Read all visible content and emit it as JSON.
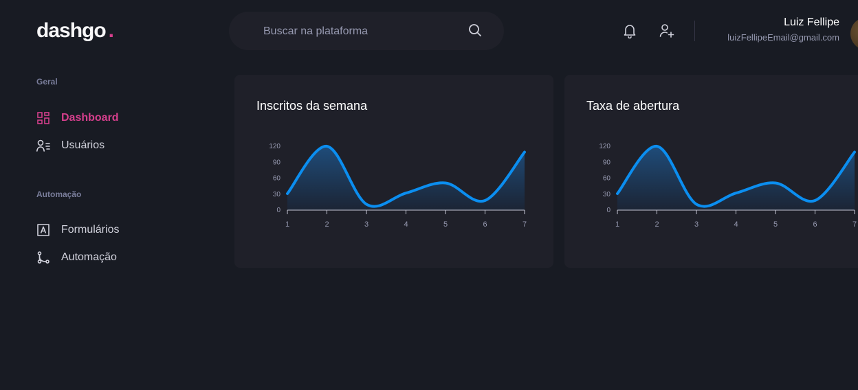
{
  "header": {
    "logo_text": "dashgo",
    "logo_dot": ".",
    "search_placeholder": "Buscar na plataforma",
    "profile": {
      "name": "Luiz Fellipe",
      "email": "luizFellipeEmail@gmail.com"
    }
  },
  "sidebar": {
    "sections": [
      {
        "title": "Geral",
        "items": [
          {
            "label": "Dashboard",
            "icon": "dashboard-icon",
            "active": true
          },
          {
            "label": "Usuários",
            "icon": "users-icon",
            "active": false
          }
        ]
      },
      {
        "title": "Automação",
        "items": [
          {
            "label": "Formulários",
            "icon": "form-icon",
            "active": false
          },
          {
            "label": "Automação",
            "icon": "git-branch-icon",
            "active": false
          }
        ]
      }
    ]
  },
  "colors": {
    "background": "#181b23",
    "card": "#1f2029",
    "accent": "#d53f8c",
    "line": "#0b8ef0"
  },
  "chart_data": [
    {
      "type": "area",
      "title": "Inscritos da semana",
      "x": [
        1,
        2,
        3,
        4,
        5,
        6,
        7
      ],
      "values": [
        31,
        120,
        11,
        32,
        51,
        18,
        109
      ],
      "yticks": [
        0,
        30,
        60,
        90,
        120
      ],
      "ylim": [
        0,
        120
      ],
      "xlabel": "",
      "ylabel": ""
    },
    {
      "type": "area",
      "title": "Taxa de abertura",
      "x": [
        1,
        2,
        3,
        4,
        5,
        6,
        7
      ],
      "values": [
        31,
        120,
        11,
        32,
        51,
        18,
        109
      ],
      "yticks": [
        0,
        30,
        60,
        90,
        120
      ],
      "ylim": [
        0,
        120
      ],
      "xlabel": "",
      "ylabel": ""
    }
  ]
}
